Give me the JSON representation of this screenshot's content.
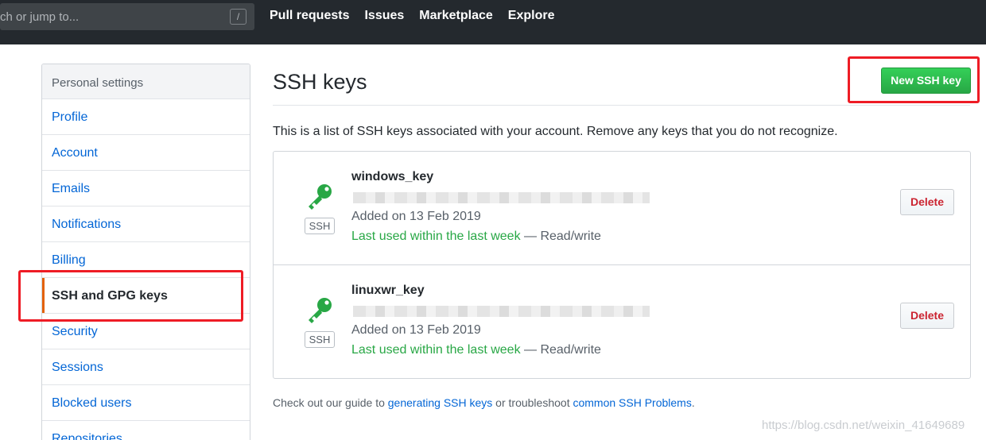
{
  "topnav": {
    "search_placeholder": "ch or jump to...",
    "search_shortcut": "/",
    "links": [
      "Pull requests",
      "Issues",
      "Marketplace",
      "Explore"
    ]
  },
  "sidebar": {
    "header": "Personal settings",
    "items": [
      {
        "label": "Profile"
      },
      {
        "label": "Account"
      },
      {
        "label": "Emails"
      },
      {
        "label": "Notifications"
      },
      {
        "label": "Billing"
      },
      {
        "label": "SSH and GPG keys",
        "selected": true
      },
      {
        "label": "Security"
      },
      {
        "label": "Sessions"
      },
      {
        "label": "Blocked users"
      },
      {
        "label": "Repositories"
      }
    ]
  },
  "main": {
    "title": "SSH keys",
    "new_button": "New SSH key",
    "intro": "This is a list of SSH keys associated with your account. Remove any keys that you do not recognize.",
    "keys": [
      {
        "name": "windows_key",
        "badge": "SSH",
        "added": "Added on 13 Feb 2019",
        "last_used": "Last used within the last week",
        "access": " — Read/write",
        "delete_label": "Delete"
      },
      {
        "name": "linuxwr_key",
        "badge": "SSH",
        "added": "Added on 13 Feb 2019",
        "last_used": "Last used within the last week",
        "access": " — Read/write",
        "delete_label": "Delete"
      }
    ],
    "footer": {
      "prefix": "Check out our guide to ",
      "link1": "generating SSH keys",
      "middle": " or troubleshoot ",
      "link2": "common SSH Problems",
      "suffix": "."
    }
  },
  "watermark": "https://blog.csdn.net/weixin_41649689",
  "colors": {
    "nav_bg": "#24292e",
    "link_blue": "#0366d6",
    "green": "#28a745",
    "delete_red": "#cb2431",
    "annotation_red": "#ee1c25",
    "selected_accent": "#e36209"
  },
  "icons": {
    "key": "key-icon",
    "slash": "slash-icon"
  }
}
